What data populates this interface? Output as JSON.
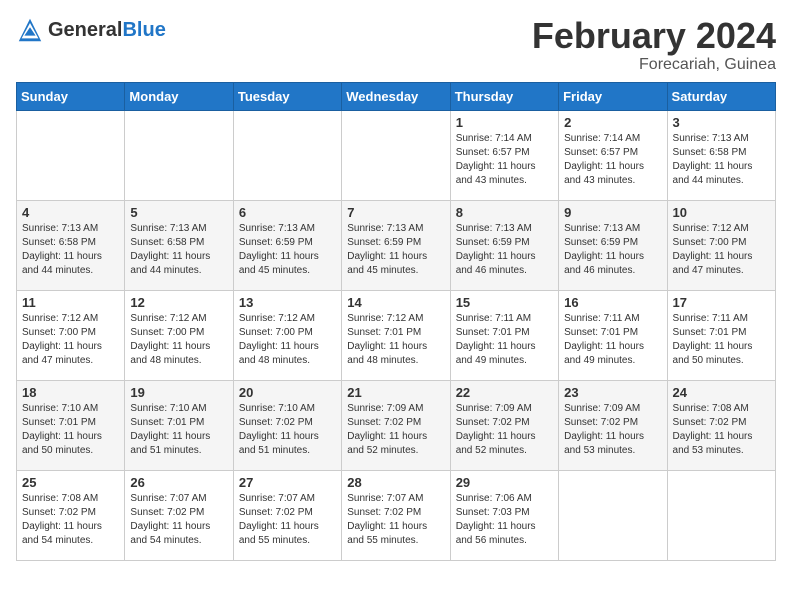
{
  "header": {
    "logo_general": "General",
    "logo_blue": "Blue",
    "title": "February 2024",
    "subtitle": "Forecariah, Guinea"
  },
  "days_of_week": [
    "Sunday",
    "Monday",
    "Tuesday",
    "Wednesday",
    "Thursday",
    "Friday",
    "Saturday"
  ],
  "weeks": [
    [
      {
        "day": "",
        "info": ""
      },
      {
        "day": "",
        "info": ""
      },
      {
        "day": "",
        "info": ""
      },
      {
        "day": "",
        "info": ""
      },
      {
        "day": "1",
        "info": "Sunrise: 7:14 AM\nSunset: 6:57 PM\nDaylight: 11 hours\nand 43 minutes."
      },
      {
        "day": "2",
        "info": "Sunrise: 7:14 AM\nSunset: 6:57 PM\nDaylight: 11 hours\nand 43 minutes."
      },
      {
        "day": "3",
        "info": "Sunrise: 7:13 AM\nSunset: 6:58 PM\nDaylight: 11 hours\nand 44 minutes."
      }
    ],
    [
      {
        "day": "4",
        "info": "Sunrise: 7:13 AM\nSunset: 6:58 PM\nDaylight: 11 hours\nand 44 minutes."
      },
      {
        "day": "5",
        "info": "Sunrise: 7:13 AM\nSunset: 6:58 PM\nDaylight: 11 hours\nand 44 minutes."
      },
      {
        "day": "6",
        "info": "Sunrise: 7:13 AM\nSunset: 6:59 PM\nDaylight: 11 hours\nand 45 minutes."
      },
      {
        "day": "7",
        "info": "Sunrise: 7:13 AM\nSunset: 6:59 PM\nDaylight: 11 hours\nand 45 minutes."
      },
      {
        "day": "8",
        "info": "Sunrise: 7:13 AM\nSunset: 6:59 PM\nDaylight: 11 hours\nand 46 minutes."
      },
      {
        "day": "9",
        "info": "Sunrise: 7:13 AM\nSunset: 6:59 PM\nDaylight: 11 hours\nand 46 minutes."
      },
      {
        "day": "10",
        "info": "Sunrise: 7:12 AM\nSunset: 7:00 PM\nDaylight: 11 hours\nand 47 minutes."
      }
    ],
    [
      {
        "day": "11",
        "info": "Sunrise: 7:12 AM\nSunset: 7:00 PM\nDaylight: 11 hours\nand 47 minutes."
      },
      {
        "day": "12",
        "info": "Sunrise: 7:12 AM\nSunset: 7:00 PM\nDaylight: 11 hours\nand 48 minutes."
      },
      {
        "day": "13",
        "info": "Sunrise: 7:12 AM\nSunset: 7:00 PM\nDaylight: 11 hours\nand 48 minutes."
      },
      {
        "day": "14",
        "info": "Sunrise: 7:12 AM\nSunset: 7:01 PM\nDaylight: 11 hours\nand 48 minutes."
      },
      {
        "day": "15",
        "info": "Sunrise: 7:11 AM\nSunset: 7:01 PM\nDaylight: 11 hours\nand 49 minutes."
      },
      {
        "day": "16",
        "info": "Sunrise: 7:11 AM\nSunset: 7:01 PM\nDaylight: 11 hours\nand 49 minutes."
      },
      {
        "day": "17",
        "info": "Sunrise: 7:11 AM\nSunset: 7:01 PM\nDaylight: 11 hours\nand 50 minutes."
      }
    ],
    [
      {
        "day": "18",
        "info": "Sunrise: 7:10 AM\nSunset: 7:01 PM\nDaylight: 11 hours\nand 50 minutes."
      },
      {
        "day": "19",
        "info": "Sunrise: 7:10 AM\nSunset: 7:01 PM\nDaylight: 11 hours\nand 51 minutes."
      },
      {
        "day": "20",
        "info": "Sunrise: 7:10 AM\nSunset: 7:02 PM\nDaylight: 11 hours\nand 51 minutes."
      },
      {
        "day": "21",
        "info": "Sunrise: 7:09 AM\nSunset: 7:02 PM\nDaylight: 11 hours\nand 52 minutes."
      },
      {
        "day": "22",
        "info": "Sunrise: 7:09 AM\nSunset: 7:02 PM\nDaylight: 11 hours\nand 52 minutes."
      },
      {
        "day": "23",
        "info": "Sunrise: 7:09 AM\nSunset: 7:02 PM\nDaylight: 11 hours\nand 53 minutes."
      },
      {
        "day": "24",
        "info": "Sunrise: 7:08 AM\nSunset: 7:02 PM\nDaylight: 11 hours\nand 53 minutes."
      }
    ],
    [
      {
        "day": "25",
        "info": "Sunrise: 7:08 AM\nSunset: 7:02 PM\nDaylight: 11 hours\nand 54 minutes."
      },
      {
        "day": "26",
        "info": "Sunrise: 7:07 AM\nSunset: 7:02 PM\nDaylight: 11 hours\nand 54 minutes."
      },
      {
        "day": "27",
        "info": "Sunrise: 7:07 AM\nSunset: 7:02 PM\nDaylight: 11 hours\nand 55 minutes."
      },
      {
        "day": "28",
        "info": "Sunrise: 7:07 AM\nSunset: 7:02 PM\nDaylight: 11 hours\nand 55 minutes."
      },
      {
        "day": "29",
        "info": "Sunrise: 7:06 AM\nSunset: 7:03 PM\nDaylight: 11 hours\nand 56 minutes."
      },
      {
        "day": "",
        "info": ""
      },
      {
        "day": "",
        "info": ""
      }
    ]
  ]
}
